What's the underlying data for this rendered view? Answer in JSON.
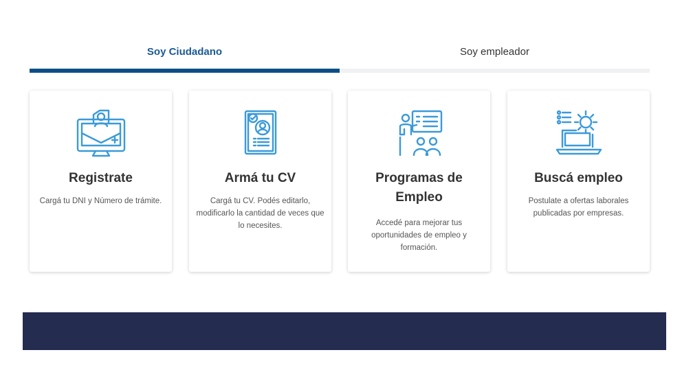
{
  "tabs": [
    {
      "label": "Soy Ciudadano",
      "active": true
    },
    {
      "label": "Soy empleador",
      "active": false
    }
  ],
  "cards": [
    {
      "icon": "computer-user-icon",
      "title": "Registrate",
      "desc": "Cargá tu DNI y Número de trámite."
    },
    {
      "icon": "cv-document-icon",
      "title": "Armá tu CV",
      "desc": "Cargá tu CV. Podés editarlo, modificarlo la cantidad de veces que lo necesites."
    },
    {
      "icon": "training-presentation-icon",
      "title": "Programas de Empleo",
      "desc": "Accedé para mejorar tus oportunidades de empleo y formación."
    },
    {
      "icon": "laptop-gear-icon",
      "title": "Buscá empleo",
      "desc": "Postulate a ofertas laborales publicadas por empresas."
    }
  ],
  "colors": {
    "accent": "#0b4f86",
    "icon": "#3a9ad9",
    "band": "#242c4f"
  }
}
